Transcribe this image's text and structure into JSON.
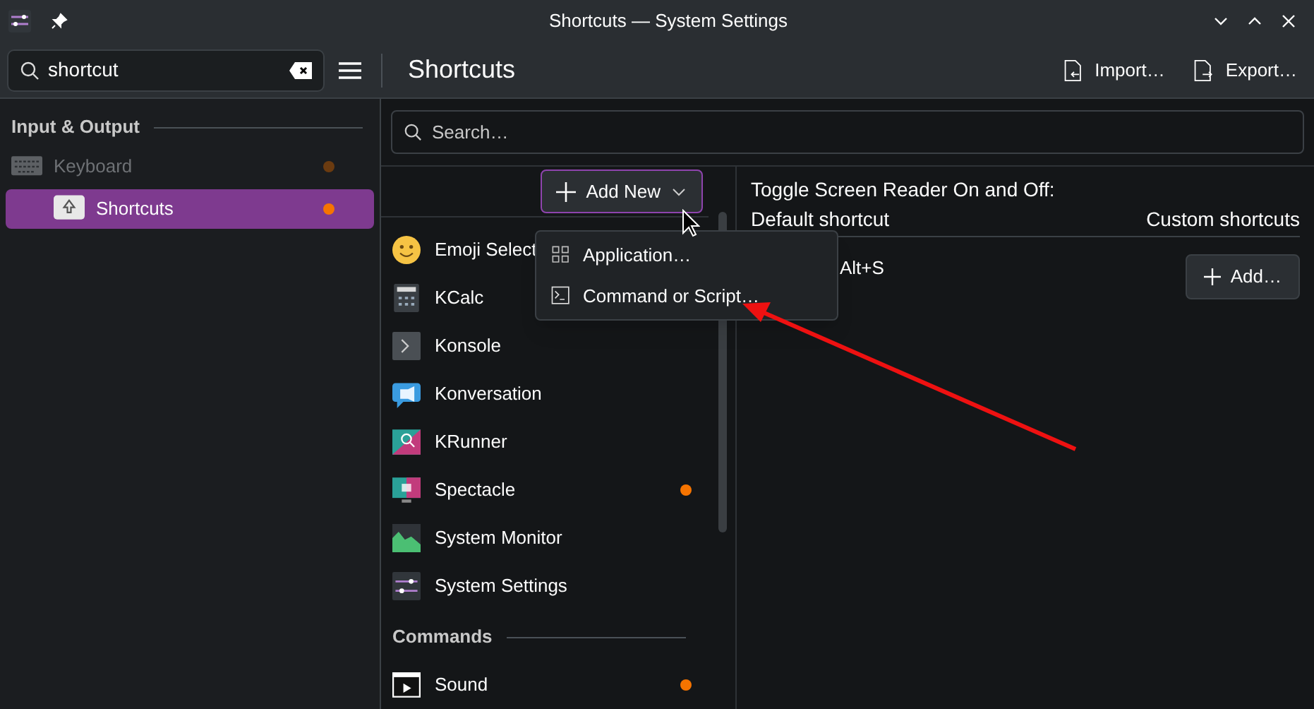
{
  "window": {
    "title": "Shortcuts — System Settings"
  },
  "sidebar": {
    "search": {
      "value": "shortcut"
    },
    "sections": [
      {
        "header": "Input & Output",
        "items": [
          {
            "label": "Keyboard",
            "kind": "keyboard",
            "selected": false,
            "disabled": true,
            "modified": true,
            "children": [
              {
                "label": "Shortcuts",
                "kind": "shortcut",
                "selected": true,
                "disabled": false,
                "modified": true
              }
            ]
          }
        ]
      }
    ]
  },
  "page": {
    "title": "Shortcuts",
    "actions": [
      {
        "label": "Import…",
        "kind": "import"
      },
      {
        "label": "Export…",
        "kind": "export"
      }
    ]
  },
  "list": {
    "search": {
      "placeholder": "Search…"
    },
    "add_new": {
      "label": "Add New",
      "expanded": true,
      "menu": [
        {
          "label": "Application…",
          "kind": "grid"
        },
        {
          "label": "Command or Script…",
          "kind": "terminal"
        }
      ]
    },
    "groups": [
      {
        "items": [
          {
            "label": "Emoji Select",
            "kind": "emoji",
            "modified": false
          },
          {
            "label": "KCalc",
            "kind": "calc",
            "modified": false
          },
          {
            "label": "Konsole",
            "kind": "konsole",
            "modified": false
          },
          {
            "label": "Konversation",
            "kind": "chat",
            "modified": false
          },
          {
            "label": "KRunner",
            "kind": "runner",
            "modified": false
          },
          {
            "label": "Spectacle",
            "kind": "camera",
            "modified": true
          },
          {
            "label": "System Monitor",
            "kind": "monitor",
            "modified": false
          },
          {
            "label": "System Settings",
            "kind": "settings",
            "modified": false
          }
        ]
      },
      {
        "header": "Commands",
        "items": [
          {
            "label": "Sound",
            "kind": "play",
            "modified": true
          }
        ]
      }
    ]
  },
  "detail": {
    "title": "Toggle Screen Reader On and Off:",
    "columns": [
      "Default shortcut",
      "Custom shortcuts"
    ],
    "default_value": "Alt+S",
    "add_button": "Add…"
  }
}
